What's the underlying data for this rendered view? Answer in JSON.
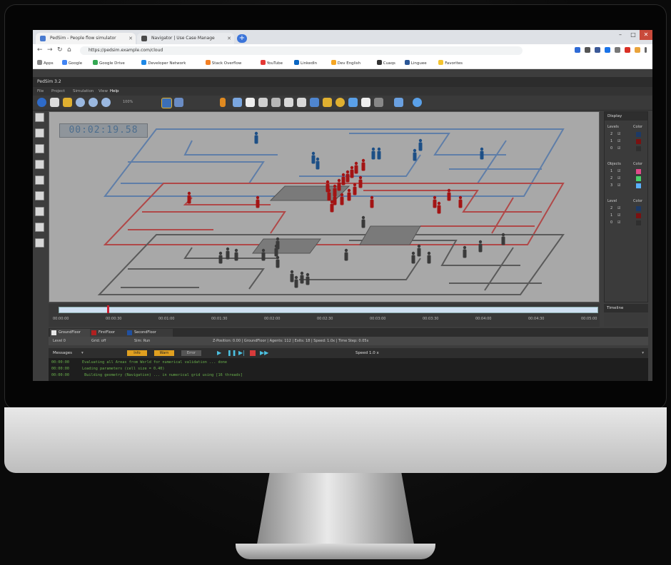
{
  "browser": {
    "tabs": [
      {
        "label": "PedSim - People flow simulator",
        "icon_color": "#4a7bd0"
      },
      {
        "label": "Navigator | Use Case Manage",
        "icon_color": "#4a4a4a"
      }
    ],
    "new_tab_label": "+",
    "url": "https://pedsim.example.com/cloud",
    "bookmarks": [
      {
        "label": "Apps",
        "color": "#888888"
      },
      {
        "label": "Google",
        "color": "#4285f4"
      },
      {
        "label": "Google Drive",
        "color": "#34a853"
      },
      {
        "label": "Developer Network",
        "color": "#1e88e5"
      },
      {
        "label": "Stack Overflow",
        "color": "#f48024"
      },
      {
        "label": "YouTube",
        "color": "#e53935"
      },
      {
        "label": "LinkedIn",
        "color": "#0a66c2"
      },
      {
        "label": "Dev English",
        "color": "#f5a623"
      },
      {
        "label": "Cuaqs",
        "color": "#333333"
      },
      {
        "label": "Linguee",
        "color": "#2b5797"
      },
      {
        "label": "Favorites",
        "color": "#f4c430"
      }
    ]
  },
  "app": {
    "title": "PedSim 3.2",
    "menu": [
      "File",
      "Project",
      "Simulation",
      "View",
      "Help"
    ],
    "zoom_label": "100%",
    "clock": "00:02:19.58"
  },
  "right_panel": {
    "title": "Display",
    "sections": [
      {
        "title": "Levels",
        "col": "Color",
        "rows": [
          {
            "label": "2",
            "color": "#1d3a66"
          },
          {
            "label": "1",
            "color": "#7a1111"
          },
          {
            "label": "0",
            "color": "#2f2f2f"
          }
        ]
      },
      {
        "title": "Objects",
        "col": "Color",
        "rows": [
          {
            "label": "1",
            "color": "#e04a8a"
          },
          {
            "label": "2",
            "color": "#4ad06a"
          },
          {
            "label": "3",
            "color": "#5ab0ff"
          }
        ]
      },
      {
        "title": "Level",
        "col": "Color",
        "rows": [
          {
            "label": "2",
            "color": "#1d3a66"
          },
          {
            "label": "1",
            "color": "#7a1111"
          },
          {
            "label": "0",
            "color": "#2f2f2f"
          }
        ]
      }
    ]
  },
  "timeline": {
    "labels": [
      "00:00:00",
      "00:00:30",
      "00:01:00",
      "00:01:30",
      "00:02:00",
      "00:02:30",
      "00:03:00",
      "00:03:30",
      "00:04:00",
      "00:04:30",
      "00:05:00"
    ],
    "progress": 0.09,
    "panel_title": "Timeline"
  },
  "layer_tabs": [
    {
      "label": "GroundFloor",
      "color": "#e8e8e8"
    },
    {
      "label": "FirstFloor",
      "color": "#b02020"
    },
    {
      "label": "SecondFloor",
      "color": "#2050a0"
    }
  ],
  "status": [
    "Level 0",
    "Grid: off",
    "Sim: Run",
    "Z-Position: 0.00 | GroundFloor | Agents: 112 | Exits: 18 | Speed: 1.0x | Time Step: 0.05s"
  ],
  "messages": {
    "title": "Messages",
    "filters": [
      "Info",
      "Warn",
      "Error"
    ],
    "speed_label": "Speed 1.0 x",
    "lines": [
      {
        "time": "00:00:00",
        "text": "Evaluating all Areas from World for numerical validation ... done"
      },
      {
        "time": "00:00:00",
        "text": "Loading parameters (cell size = 0.40)"
      },
      {
        "time": "00:00:00",
        "text": "   Building geometry (Navigation)   ...   in numerical grid using [16 threads]"
      }
    ]
  }
}
